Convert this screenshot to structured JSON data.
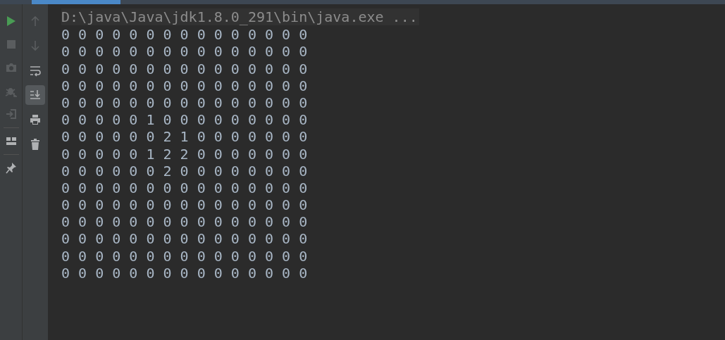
{
  "run_toolbar": [
    {
      "kind": "run",
      "disabled": false
    },
    {
      "kind": "stop",
      "disabled": true
    },
    {
      "kind": "camera",
      "disabled": true
    },
    {
      "kind": "debug",
      "disabled": true
    },
    {
      "kind": "exit",
      "disabled": true
    },
    {
      "kind": "separator"
    },
    {
      "kind": "layout",
      "disabled": false
    },
    {
      "kind": "separator"
    },
    {
      "kind": "pin",
      "disabled": false
    }
  ],
  "console_toolbar": [
    {
      "kind": "up",
      "selected": false,
      "disabled": true
    },
    {
      "kind": "down",
      "selected": false,
      "disabled": true
    },
    {
      "kind": "wrap",
      "selected": false,
      "disabled": false
    },
    {
      "kind": "scroll-end",
      "selected": true,
      "disabled": false
    },
    {
      "kind": "print",
      "selected": false,
      "disabled": false
    },
    {
      "kind": "trash",
      "selected": false,
      "disabled": false
    }
  ],
  "console": {
    "command": "D:\\java\\Java\\jdk1.8.0_291\\bin\\java.exe ...",
    "lines": [
      "0 0 0 0 0 0 0 0 0 0 0 0 0 0 0",
      "0 0 0 0 0 0 0 0 0 0 0 0 0 0 0",
      "0 0 0 0 0 0 0 0 0 0 0 0 0 0 0",
      "0 0 0 0 0 0 0 0 0 0 0 0 0 0 0",
      "0 0 0 0 0 0 0 0 0 0 0 0 0 0 0",
      "0 0 0 0 0 1 0 0 0 0 0 0 0 0 0",
      "0 0 0 0 0 0 2 1 0 0 0 0 0 0 0",
      "0 0 0 0 0 1 2 2 0 0 0 0 0 0 0",
      "0 0 0 0 0 0 2 0 0 0 0 0 0 0 0",
      "0 0 0 0 0 0 0 0 0 0 0 0 0 0 0",
      "0 0 0 0 0 0 0 0 0 0 0 0 0 0 0",
      "0 0 0 0 0 0 0 0 0 0 0 0 0 0 0",
      "0 0 0 0 0 0 0 0 0 0 0 0 0 0 0",
      "0 0 0 0 0 0 0 0 0 0 0 0 0 0 0",
      "0 0 0 0 0 0 0 0 0 0 0 0 0 0 0"
    ]
  }
}
